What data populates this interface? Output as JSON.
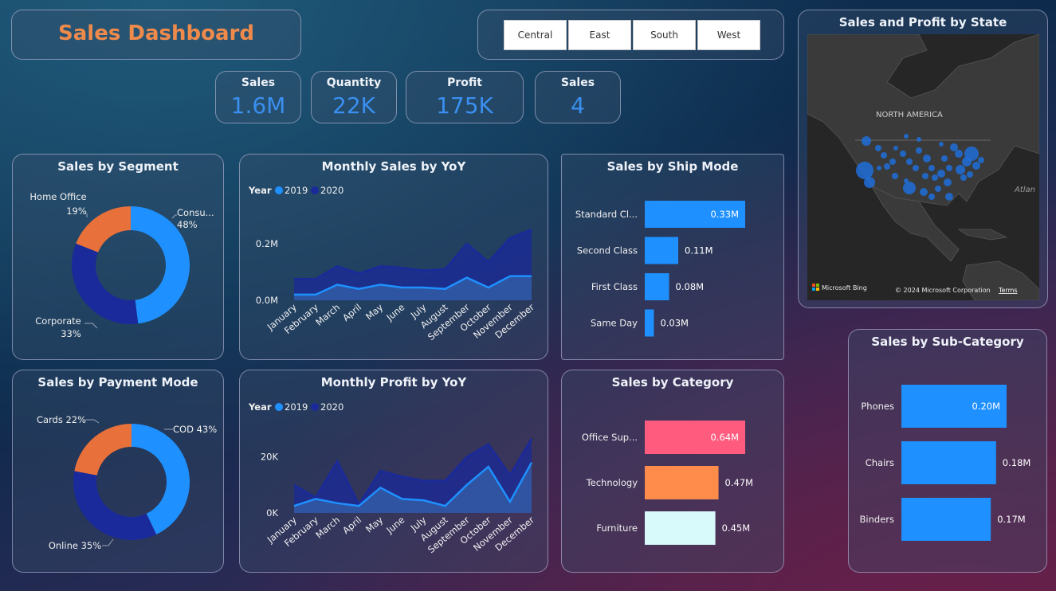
{
  "header": {
    "title": "Sales Dashboard"
  },
  "slicer": {
    "options": [
      "Central",
      "East",
      "South",
      "West"
    ]
  },
  "kpis": [
    {
      "label": "Sales",
      "value": "1.6M"
    },
    {
      "label": "Quantity",
      "value": "22K"
    },
    {
      "label": "Profit",
      "value": "175K"
    },
    {
      "label": "Sales",
      "value": "4"
    }
  ],
  "colors": {
    "accent": "#1e90ff",
    "dark_series": "#1a2a9a",
    "orange": "#e8703a",
    "title_orange": "#f08a4b",
    "pink": "#ff5b7f",
    "light_orange": "#ff8c4a",
    "mint": "#d8fafa"
  },
  "segment": {
    "title": "Sales by Segment",
    "chart_data": {
      "type": "pie",
      "labels": [
        "Consu...",
        "Corporate",
        "Home Office"
      ],
      "values": [
        48,
        33,
        19
      ],
      "label_text": [
        "48%",
        "33%",
        "19%"
      ],
      "colors": [
        "#1e90ff",
        "#1a2a9a",
        "#e8703a"
      ]
    }
  },
  "payment": {
    "title": "Sales by Payment Mode",
    "chart_data": {
      "type": "pie",
      "labels": [
        "COD 43%",
        "Online 35%",
        "Cards 22%"
      ],
      "values": [
        43,
        35,
        22
      ],
      "colors": [
        "#1e90ff",
        "#1a2a9a",
        "#e8703a"
      ]
    }
  },
  "monthly_sales": {
    "title": "Monthly Sales by YoY",
    "legend_title": "Year",
    "chart_data": {
      "type": "area",
      "categories": [
        "January",
        "February",
        "March",
        "April",
        "May",
        "June",
        "July",
        "August",
        "September",
        "October",
        "November",
        "December"
      ],
      "series": [
        {
          "name": "2019",
          "values": [
            0.02,
            0.02,
            0.055,
            0.04,
            0.055,
            0.045,
            0.045,
            0.04,
            0.08,
            0.045,
            0.085,
            0.085
          ]
        },
        {
          "name": "2020",
          "values": [
            0.075,
            0.075,
            0.12,
            0.095,
            0.12,
            0.115,
            0.105,
            0.11,
            0.2,
            0.135,
            0.22,
            0.25
          ]
        }
      ],
      "yticks": [
        "0.0M",
        "0.2M"
      ],
      "ylim": [
        0,
        0.27
      ]
    }
  },
  "monthly_profit": {
    "title": "Monthly Profit by YoY",
    "legend_title": "Year",
    "chart_data": {
      "type": "area",
      "categories": [
        "January",
        "February",
        "March",
        "April",
        "May",
        "June",
        "July",
        "August",
        "September",
        "October",
        "November",
        "December"
      ],
      "series": [
        {
          "name": "2019",
          "values": [
            2500,
            5000,
            3500,
            2500,
            9000,
            5000,
            4500,
            2500,
            10000,
            16500,
            4000,
            18000
          ]
        },
        {
          "name": "2020",
          "values": [
            10000,
            5500,
            18500,
            3000,
            15000,
            13000,
            11500,
            11500,
            20000,
            24500,
            13500,
            26500
          ]
        }
      ],
      "yticks": [
        "0K",
        "20K"
      ],
      "ylim": [
        0,
        29000
      ]
    }
  },
  "ship_mode": {
    "title": "Sales by Ship Mode",
    "chart_data": {
      "type": "bar",
      "categories": [
        "Standard Cl...",
        "Second Class",
        "First Class",
        "Same Day"
      ],
      "values": [
        0.33,
        0.11,
        0.08,
        0.03
      ],
      "value_labels": [
        "0.33M",
        "0.11M",
        "0.08M",
        "0.03M"
      ],
      "colors": [
        "#1e90ff",
        "#1e90ff",
        "#1e90ff",
        "#1e90ff"
      ]
    }
  },
  "category": {
    "title": "Sales by Category",
    "chart_data": {
      "type": "bar",
      "categories": [
        "Office Sup...",
        "Technology",
        "Furniture"
      ],
      "values": [
        0.64,
        0.47,
        0.45
      ],
      "value_labels": [
        "0.64M",
        "0.47M",
        "0.45M"
      ],
      "colors": [
        "#ff5b7f",
        "#ff8c4a",
        "#d8fafa"
      ]
    }
  },
  "subcategory": {
    "title": "Sales by Sub-Category",
    "chart_data": {
      "type": "bar",
      "categories": [
        "Phones",
        "Chairs",
        "Binders"
      ],
      "values": [
        0.2,
        0.18,
        0.17
      ],
      "value_labels": [
        "0.20M",
        "0.18M",
        "0.17M"
      ],
      "colors": [
        "#1e90ff",
        "#1e90ff",
        "#1e90ff"
      ]
    }
  },
  "map": {
    "title": "Sales and Profit by State",
    "region_label": "NORTH AMERICA",
    "ocean_label": "Atlan",
    "brand": "Microsoft Bing",
    "copyright": "© 2024 Microsoft Corporation",
    "terms": "Terms"
  }
}
